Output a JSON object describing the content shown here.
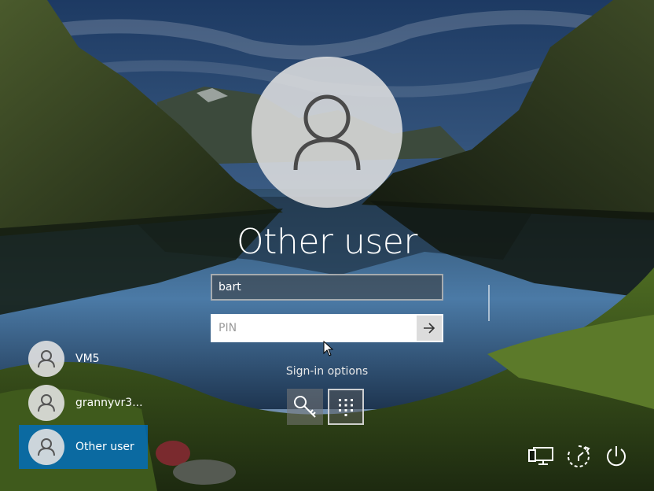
{
  "screen": {
    "selected_user": "Other user",
    "username_value": "bart",
    "pin_placeholder": "PIN",
    "signin_options_label": "Sign-in options",
    "submit_icon": "arrow-right-icon"
  },
  "signin_options": [
    {
      "name": "security-key",
      "icon": "key-icon"
    },
    {
      "name": "pin",
      "icon": "keypad-icon",
      "selected": true
    }
  ],
  "users": [
    {
      "name": "VM5",
      "selected": false
    },
    {
      "name": "grannyvr3...",
      "selected": false
    },
    {
      "name": "Other user",
      "selected": true
    }
  ],
  "system_buttons": [
    {
      "name": "network",
      "icon": "network-icon"
    },
    {
      "name": "ease-of-access",
      "icon": "ease-of-access-icon"
    },
    {
      "name": "power",
      "icon": "power-icon"
    }
  ],
  "colors": {
    "selected_user_bg": "#006EBE",
    "avatar_bg": "#E1E1E1",
    "sky": "#24446E",
    "lake": "#2A4F78"
  }
}
